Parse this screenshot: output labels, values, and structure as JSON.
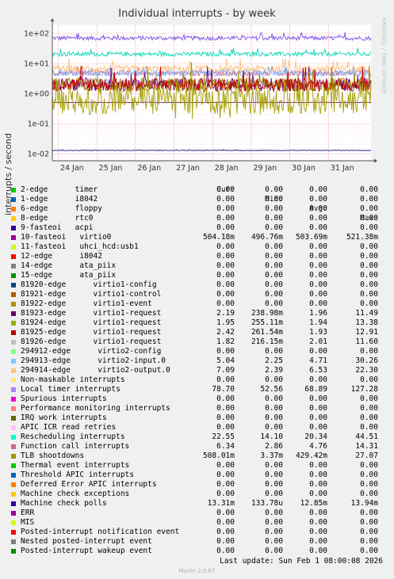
{
  "header": {
    "title": "Individual interrupts - by week",
    "watermark": "RRDTOOL / TOBI OETIKER",
    "ylabel": "interrupts / second"
  },
  "chart_data": {
    "type": "line",
    "title": "Individual interrupts - by week",
    "ylabel": "interrupts / second",
    "yscale": "log",
    "yticks": [
      "1e+02",
      "1e+01",
      "1e+00",
      "1e-01",
      "1e-02"
    ],
    "ylim": [
      0.007,
      200
    ],
    "xticks": [
      "24 Jan",
      "25 Jan",
      "26 Jan",
      "27 Jan",
      "28 Jan",
      "29 Jan",
      "30 Jan",
      "31 Jan"
    ],
    "grid": true,
    "series": [
      {
        "name": "Local timer interrupts",
        "color": "#7e54e8",
        "level": 68.89,
        "spread": 0.07
      },
      {
        "name": "Rescheduling interrupts",
        "color": "#00d8b8",
        "level": 20.34,
        "spread": 0.07
      },
      {
        "name": "Function call interrupts",
        "color": "#cc6688",
        "level": 4.76,
        "spread": 0.09
      },
      {
        "name": "294914-edge",
        "color": "#ffbf80",
        "level": 6.53,
        "spread": 0.12
      },
      {
        "name": "294913-edge",
        "color": "#80b7ff",
        "level": 4.71,
        "spread": 0.1
      },
      {
        "name": "81926-edge",
        "color": "#b0b0b0",
        "level": 2.01,
        "spread": 0.18
      },
      {
        "name": "81923-edge",
        "color": "#6a0078",
        "level": 1.96,
        "spread": 0.22
      },
      {
        "name": "81924-edge",
        "color": "#ae7a00",
        "level": 1.94,
        "spread": 0.22
      },
      {
        "name": "81925-edge",
        "color": "#c00000",
        "level": 1.93,
        "spread": 0.22
      },
      {
        "name": "10-fasteoi",
        "color": "#6a1060",
        "level": 0.5037,
        "spread": 0.005
      },
      {
        "name": "TLB shootdowns",
        "color": "#a4a000",
        "level": 0.42942,
        "spread": 0.45
      },
      {
        "name": "Machine check polls",
        "color": "#1a0a8c",
        "level": 0.01285,
        "spread": 0.01
      }
    ]
  },
  "legend": {
    "headers": [
      "Cur:",
      "Min:",
      "Avg:",
      "Max:"
    ],
    "rows": [
      {
        "name": "2-edge      timer",
        "color": "#00cc00",
        "cur": "0.00",
        "min": "0.00",
        "avg": "0.00",
        "max": "0.00"
      },
      {
        "name": "1-edge      i8042",
        "color": "#0066b3",
        "cur": "0.00",
        "min": "0.00",
        "avg": "0.00",
        "max": "0.00"
      },
      {
        "name": "6-edge      floppy",
        "color": "#ff8000",
        "cur": "0.00",
        "min": "0.00",
        "avg": "0.00",
        "max": "0.00"
      },
      {
        "name": "8-edge      rtc0",
        "color": "#ffcc00",
        "cur": "0.00",
        "min": "0.00",
        "avg": "0.00",
        "max": "0.00"
      },
      {
        "name": "9-fasteoi   acpi",
        "color": "#330099",
        "cur": "0.00",
        "min": "0.00",
        "avg": "0.00",
        "max": "0.00"
      },
      {
        "name": "10-fasteoi   virtio0",
        "color": "#990099",
        "cur": "504.18m",
        "min": "496.76m",
        "avg": "503.69m",
        "max": "521.38m"
      },
      {
        "name": "11-fasteoi   uhci_hcd:usb1",
        "color": "#ccff00",
        "cur": "0.00",
        "min": "0.00",
        "avg": "0.00",
        "max": "0.00"
      },
      {
        "name": "12-edge      i8042",
        "color": "#ff0000",
        "cur": "0.00",
        "min": "0.00",
        "avg": "0.00",
        "max": "0.00"
      },
      {
        "name": "14-edge      ata_piix",
        "color": "#808080",
        "cur": "0.00",
        "min": "0.00",
        "avg": "0.00",
        "max": "0.00"
      },
      {
        "name": "15-edge      ata_piix",
        "color": "#008f00",
        "cur": "0.00",
        "min": "0.00",
        "avg": "0.00",
        "max": "0.00"
      },
      {
        "name": "81920-edge      virtio1-config",
        "color": "#00487d",
        "cur": "0.00",
        "min": "0.00",
        "avg": "0.00",
        "max": "0.00"
      },
      {
        "name": "81921-edge      virtio1-control",
        "color": "#b35a00",
        "cur": "0.00",
        "min": "0.00",
        "avg": "0.00",
        "max": "0.00"
      },
      {
        "name": "81922-edge      virtio1-event",
        "color": "#b38f00",
        "cur": "0.00",
        "min": "0.00",
        "avg": "0.00",
        "max": "0.00"
      },
      {
        "name": "81923-edge      virtio1-request",
        "color": "#6b006b",
        "cur": "2.19",
        "min": "238.98m",
        "avg": "1.96",
        "max": "11.49"
      },
      {
        "name": "81924-edge      virtio1-request",
        "color": "#8fb300",
        "cur": "1.95",
        "min": "255.11m",
        "avg": "1.94",
        "max": "13.38"
      },
      {
        "name": "81925-edge      virtio1-request",
        "color": "#b30000",
        "cur": "2.42",
        "min": "261.54m",
        "avg": "1.93",
        "max": "12.91"
      },
      {
        "name": "81926-edge      virtio1-request",
        "color": "#bebebe",
        "cur": "1.82",
        "min": "216.15m",
        "avg": "2.01",
        "max": "11.60"
      },
      {
        "name": "294912-edge      virtio2-config",
        "color": "#80ff80",
        "cur": "0.00",
        "min": "0.00",
        "avg": "0.00",
        "max": "0.00"
      },
      {
        "name": "294913-edge      virtio2-input.0",
        "color": "#80c9ff",
        "cur": "5.04",
        "min": "2.25",
        "avg": "4.71",
        "max": "30.26"
      },
      {
        "name": "294914-edge      virtio2-output.0",
        "color": "#ffc080",
        "cur": "7.09",
        "min": "2.39",
        "avg": "6.53",
        "max": "22.30"
      },
      {
        "name": "Non-maskable interrupts",
        "color": "#ffe680",
        "cur": "0.00",
        "min": "0.00",
        "avg": "0.00",
        "max": "0.00"
      },
      {
        "name": "Local timer interrupts",
        "color": "#aa80ff",
        "cur": "78.70",
        "min": "52.56",
        "avg": "68.89",
        "max": "127.28"
      },
      {
        "name": "Spurious interrupts",
        "color": "#ee00cc",
        "cur": "0.00",
        "min": "0.00",
        "avg": "0.00",
        "max": "0.00"
      },
      {
        "name": "Performance monitoring interrupts",
        "color": "#ff8080",
        "cur": "0.00",
        "min": "0.00",
        "avg": "0.00",
        "max": "0.00"
      },
      {
        "name": "IRQ work interrupts",
        "color": "#666600",
        "cur": "0.00",
        "min": "0.00",
        "avg": "0.00",
        "max": "0.00"
      },
      {
        "name": "APIC ICR read retries",
        "color": "#ffbfff",
        "cur": "0.00",
        "min": "0.00",
        "avg": "0.00",
        "max": "0.00"
      },
      {
        "name": "Rescheduling interrupts",
        "color": "#00ffcc",
        "cur": "22.55",
        "min": "14.10",
        "avg": "20.34",
        "max": "44.51"
      },
      {
        "name": "Function call interrupts",
        "color": "#cc6699",
        "cur": "6.34",
        "min": "2.86",
        "avg": "4.76",
        "max": "14.31"
      },
      {
        "name": "TLB shootdowns",
        "color": "#999900",
        "cur": "508.01m",
        "min": "3.37m",
        "avg": "429.42m",
        "max": "27.07"
      },
      {
        "name": "Thermal event interrupts",
        "color": "#00cc00",
        "cur": "0.00",
        "min": "0.00",
        "avg": "0.00",
        "max": "0.00"
      },
      {
        "name": "Threshold APIC interrupts",
        "color": "#0066b3",
        "cur": "0.00",
        "min": "0.00",
        "avg": "0.00",
        "max": "0.00"
      },
      {
        "name": "Deferred Error APIC interrupts",
        "color": "#ff8000",
        "cur": "0.00",
        "min": "0.00",
        "avg": "0.00",
        "max": "0.00"
      },
      {
        "name": "Machine check exceptions",
        "color": "#ffcc00",
        "cur": "0.00",
        "min": "0.00",
        "avg": "0.00",
        "max": "0.00"
      },
      {
        "name": "Machine check polls",
        "color": "#330099",
        "cur": "13.31m",
        "min": "133.78u",
        "avg": "12.85m",
        "max": "13.94m"
      },
      {
        "name": "ERR",
        "color": "#990099",
        "cur": "0.00",
        "min": "0.00",
        "avg": "0.00",
        "max": "0.00"
      },
      {
        "name": "MIS",
        "color": "#ccff00",
        "cur": "0.00",
        "min": "0.00",
        "avg": "0.00",
        "max": "0.00"
      },
      {
        "name": "Posted-interrupt notification event",
        "color": "#ff0000",
        "cur": "0.00",
        "min": "0.00",
        "avg": "0.00",
        "max": "0.00"
      },
      {
        "name": "Nested posted-interrupt event",
        "color": "#808080",
        "cur": "0.00",
        "min": "0.00",
        "avg": "0.00",
        "max": "0.00"
      },
      {
        "name": "Posted-interrupt wakeup event",
        "color": "#008f00",
        "cur": "0.00",
        "min": "0.00",
        "avg": "0.00",
        "max": "0.00"
      }
    ]
  },
  "footer": {
    "last_update": "Last update: Sun Feb  1 08:00:08 2026",
    "version": "Munin 2.0.67"
  }
}
